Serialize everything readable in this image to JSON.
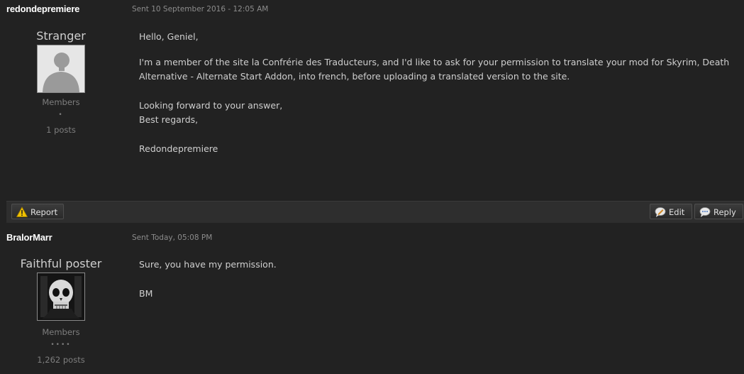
{
  "posts": [
    {
      "author": "redondepremiere",
      "sent": "Sent 10 September 2016 - 12:05 AM",
      "user_title": "Stranger",
      "avatar": "default-avatar-icon",
      "group": "Members",
      "pips": "•",
      "post_count": "1 posts",
      "body": [
        "Hello, Geniel,",
        "I'm a member of the site la Confrérie des Traducteurs, and I'd like to ask for your permission to translate your mod for Skyrim, Death Alternative - Alternate Start Addon, into french, before uploading a translated version to the site.",
        "Looking forward to your answer,",
        "Best regards,",
        "Redondepremiere"
      ],
      "actions": {
        "report": "Report",
        "edit": "Edit",
        "reply": "Reply"
      }
    },
    {
      "author": "BralorMarr",
      "sent": "Sent Today, 05:08 PM",
      "user_title": "Faithful poster",
      "avatar": "skull-avatar-icon",
      "group": "Members",
      "pips": "••••",
      "post_count": "1,262 posts",
      "body": [
        "Sure, you have my permission.",
        "BM"
      ]
    }
  ],
  "icons": {
    "report": "warning-icon",
    "edit": "edit-icon",
    "reply": "reply-icon"
  }
}
